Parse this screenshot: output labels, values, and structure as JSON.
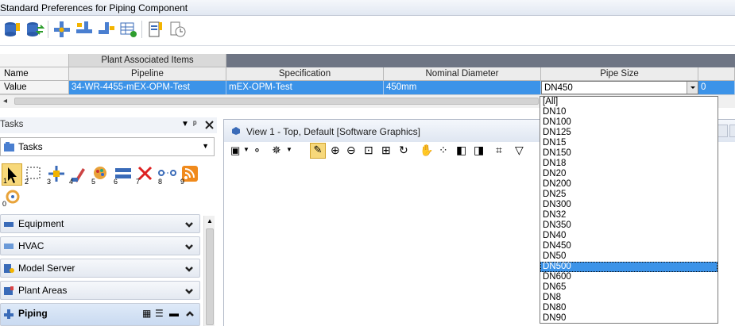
{
  "window": {
    "title": "Standard Preferences for Piping Component"
  },
  "grid": {
    "group_header": "Plant Associated Items",
    "row_name_label": "Name",
    "row_value_label": "Value",
    "columns": [
      {
        "header": "Pipeline",
        "value": "34-WR-4455-mEX-OPM-Test"
      },
      {
        "header": "Specification",
        "value": "mEX-OPM-Test"
      },
      {
        "header": "Nominal Diameter",
        "value": "450mm"
      },
      {
        "header": "Pipe Size",
        "value": "DN450"
      }
    ],
    "next_col_value": "0"
  },
  "pipe_size_dropdown": {
    "selected": "DN450",
    "highlighted": "DN500",
    "options": [
      "[All]",
      "DN10",
      "DN100",
      "DN125",
      "DN15",
      "DN150",
      "DN18",
      "DN20",
      "DN200",
      "DN25",
      "DN300",
      "DN32",
      "DN350",
      "DN40",
      "DN450",
      "DN50",
      "DN500",
      "DN600",
      "DN65",
      "DN8",
      "DN80",
      "DN90"
    ]
  },
  "tasks_panel": {
    "title": "Tasks",
    "selector_value": "Tasks",
    "tool_numbers": [
      "1",
      "2",
      "3",
      "4",
      "5",
      "6",
      "7",
      "8",
      "9",
      "0"
    ],
    "sections": [
      {
        "label": "Equipment"
      },
      {
        "label": "HVAC"
      },
      {
        "label": "Model Server"
      },
      {
        "label": "Plant Areas"
      }
    ],
    "active_section": "Piping"
  },
  "view": {
    "title": "View 1 - Top, Default [Software Graphics]"
  },
  "colors": {
    "selection": "#3c93e8",
    "highlight": "#3c93e8"
  }
}
